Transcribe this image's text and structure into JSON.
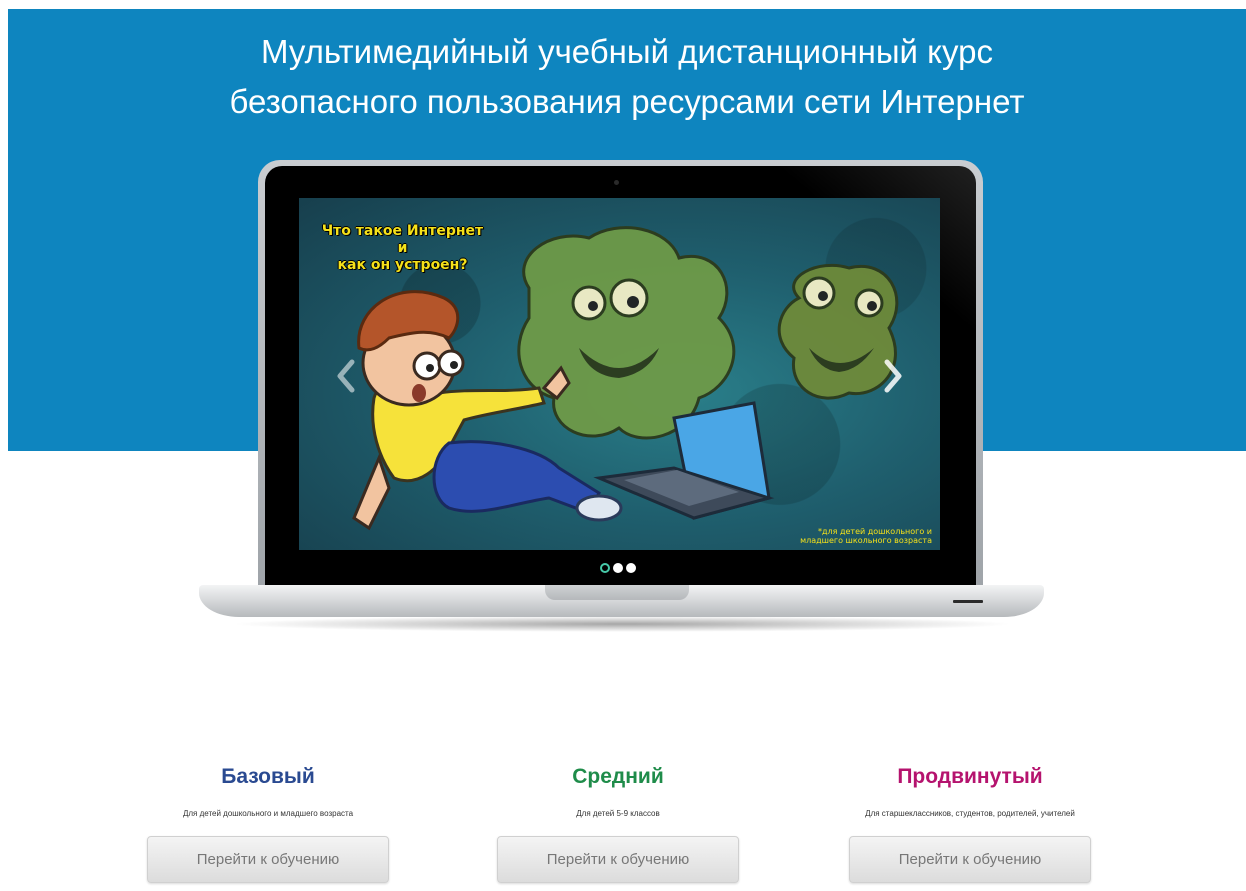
{
  "hero": {
    "title_line1": "Мультимедийный учебный дистанционный курс",
    "title_line2": "безопасного пользования ресурсами сети Интернет",
    "background_color": "#0e85bf"
  },
  "carousel": {
    "slide": {
      "caption_line1": "Что такое Интернет",
      "caption_line2": "и",
      "caption_line3": "как он устроен?",
      "note_line1": "*для детей дошкольного и",
      "note_line2": "младшего школьного возраста"
    },
    "prev_icon": "chevron-left-icon",
    "next_icon": "chevron-right-icon",
    "indicators": [
      {
        "active": true
      },
      {
        "active": false
      },
      {
        "active": false
      }
    ]
  },
  "levels": [
    {
      "title": "Базовый",
      "color": "#2a4a91",
      "description": "Для детей дошкольного и младшего возраста",
      "button_label": "Перейти к обучению"
    },
    {
      "title": "Средний",
      "color": "#1f8c4a",
      "description": "Для детей 5-9 классов",
      "button_label": "Перейти к обучению"
    },
    {
      "title": "Продвинутый",
      "color": "#b5136e",
      "description": "Для старшеклассников, студентов, родителей, учителей",
      "button_label": "Перейти к обучению"
    }
  ]
}
